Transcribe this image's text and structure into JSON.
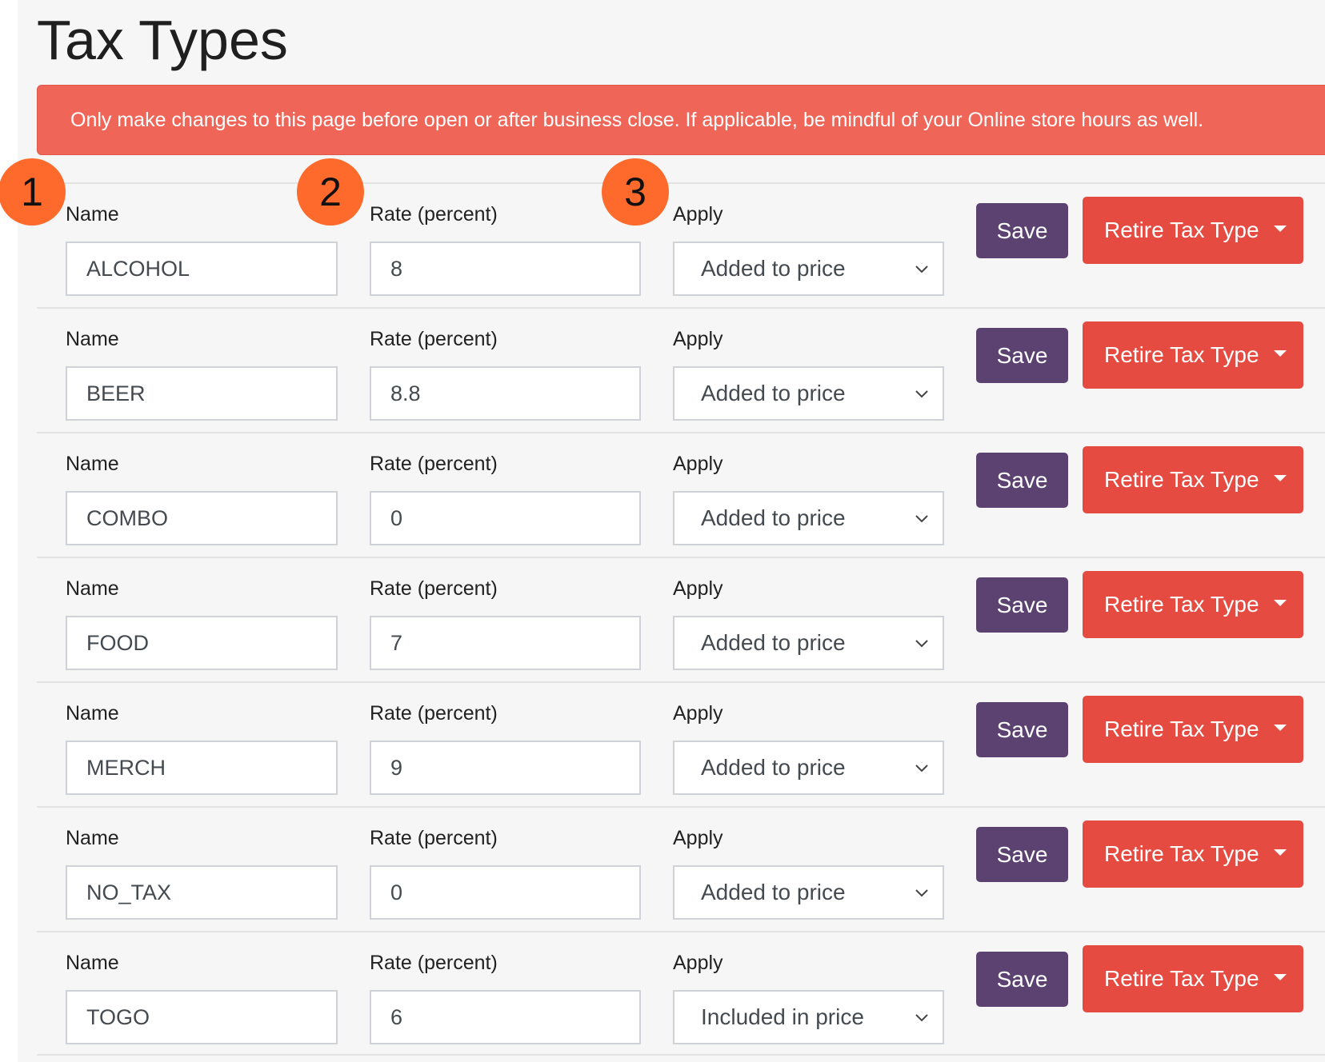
{
  "page": {
    "title": "Tax Types"
  },
  "alert": {
    "text": "Only make changes to this page before open or after business close. If applicable, be mindful of your Online store hours as well."
  },
  "labels": {
    "name": "Name",
    "rate": "Rate (percent)",
    "apply": "Apply",
    "save": "Save",
    "retire": "Retire Tax Type"
  },
  "badges": [
    "1",
    "2",
    "3"
  ],
  "tax_types": [
    {
      "name": "ALCOHOL",
      "rate": "8",
      "apply": "Added to price"
    },
    {
      "name": "BEER",
      "rate": "8.8",
      "apply": "Added to price"
    },
    {
      "name": "COMBO",
      "rate": "0",
      "apply": "Added to price"
    },
    {
      "name": "FOOD",
      "rate": "7",
      "apply": "Added to price"
    },
    {
      "name": "MERCH",
      "rate": "9",
      "apply": "Added to price"
    },
    {
      "name": "NO_TAX",
      "rate": "0",
      "apply": "Added to price"
    },
    {
      "name": "TOGO",
      "rate": "6",
      "apply": "Included in price"
    }
  ],
  "colors": {
    "alert": "#ef6558",
    "save": "#5b4270",
    "retire": "#e54b40",
    "badge": "#fd6a2b"
  }
}
